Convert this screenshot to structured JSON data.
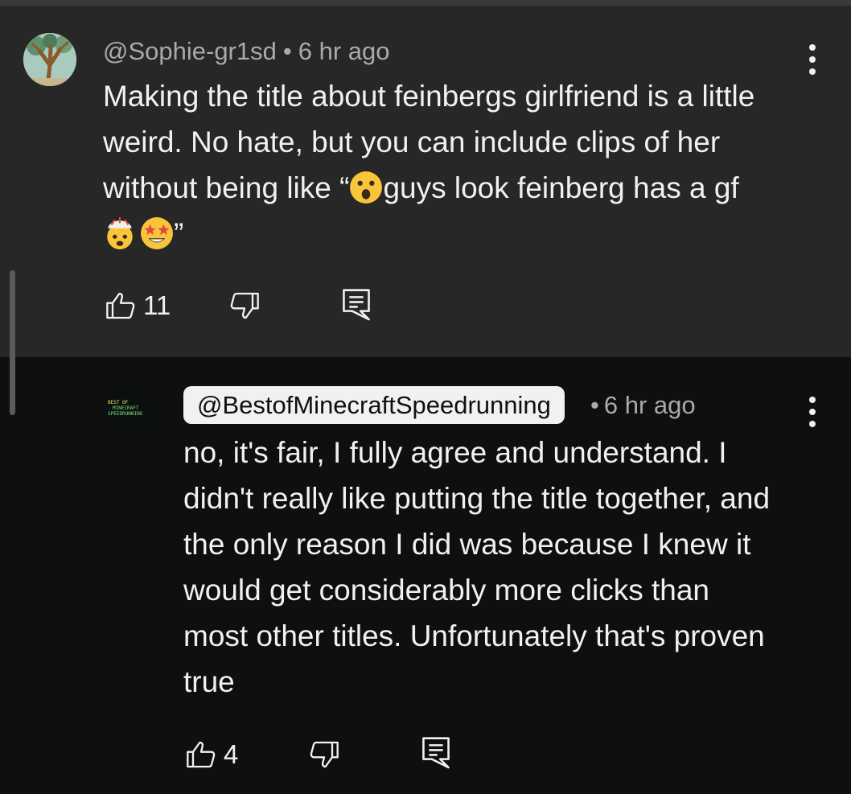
{
  "comment": {
    "author": "@Sophie-gr1sd",
    "separator": "•",
    "time": "6 hr ago",
    "text_line1": "Making the title about feinbergs girlfriend is a little",
    "text_line2": "weird. No hate, but you can include clips of her",
    "text_line3_a": "without being like “",
    "text_line3_b": "guys look feinberg has a gf",
    "text_line4_end": "”",
    "emojis": [
      "astonished-face-emoji",
      "exploding-head-emoji",
      "star-struck-emoji"
    ],
    "like_count": "11"
  },
  "reply": {
    "author": "@BestofMinecraftSpeedrunning",
    "separator": "•",
    "time": "6 hr ago",
    "lines": [
      "no, it's fair, I fully agree and understand. I",
      "didn't really like putting the title together, and",
      "the only reason I did was because I knew it",
      "would get considerably more clicks than",
      "most other titles. Unfortunately that's proven",
      "true"
    ],
    "like_count": "4",
    "avatar_text": [
      "BEST OF",
      "MINECRAFT",
      "SPEEDRUNNING"
    ]
  },
  "colors": {
    "background": "#0f0f0f",
    "highlight": "#272727",
    "text": "#f1f1f1",
    "meta": "#aaaaaa"
  }
}
